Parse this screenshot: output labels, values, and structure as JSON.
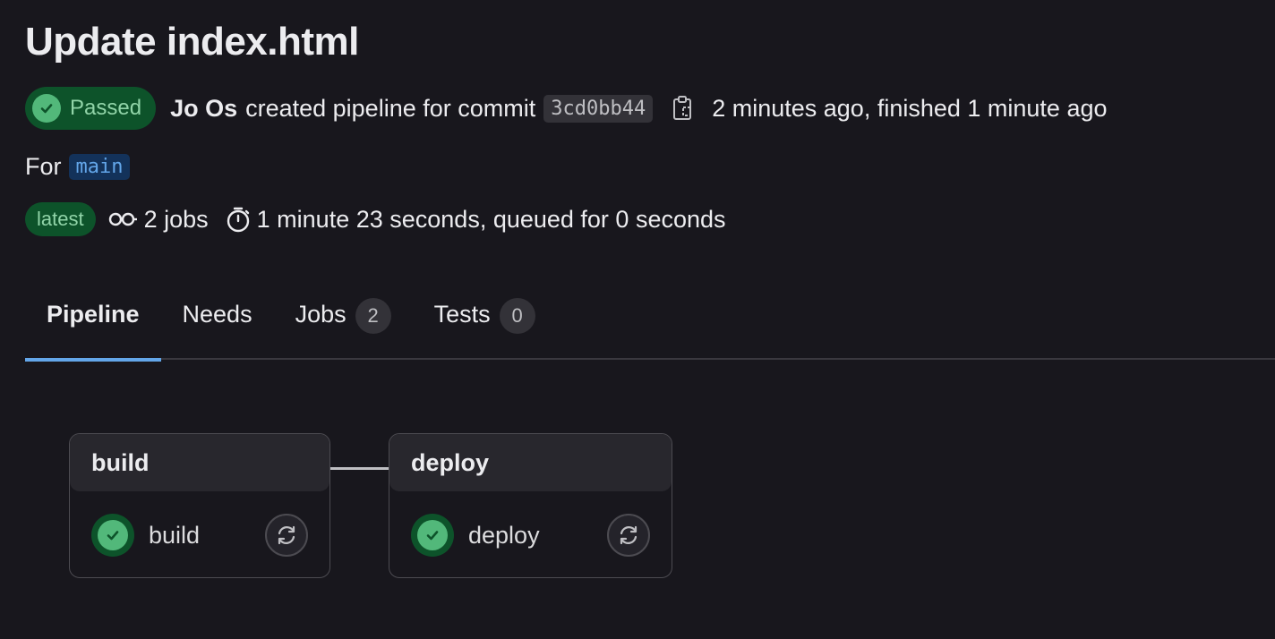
{
  "title": "Update index.html",
  "status": {
    "label": "Passed",
    "color": "#52b87a"
  },
  "commit": {
    "author": "Jo Os",
    "action_text": "created pipeline for commit",
    "sha": "3cd0bb44",
    "time_text": "2 minutes ago, finished 1 minute ago"
  },
  "ref": {
    "prefix": "For",
    "branch": "main"
  },
  "meta": {
    "latest_label": "latest",
    "jobs_text": "2 jobs",
    "duration_text": "1 minute 23 seconds, queued for 0 seconds"
  },
  "tabs": [
    {
      "label": "Pipeline",
      "active": true
    },
    {
      "label": "Needs"
    },
    {
      "label": "Jobs",
      "count": "2"
    },
    {
      "label": "Tests",
      "count": "0"
    }
  ],
  "stages": [
    {
      "name": "build",
      "jobs": [
        {
          "name": "build",
          "status": "success",
          "icon": "check-icon",
          "action_icon": "retry-icon"
        }
      ]
    },
    {
      "name": "deploy",
      "jobs": [
        {
          "name": "deploy",
          "status": "success",
          "icon": "check-icon",
          "action_icon": "retry-icon"
        }
      ]
    }
  ],
  "colors": {
    "accent": "#63a6e9",
    "success": "#52b87a",
    "success_bg": "#0d532a",
    "background": "#18171d"
  }
}
